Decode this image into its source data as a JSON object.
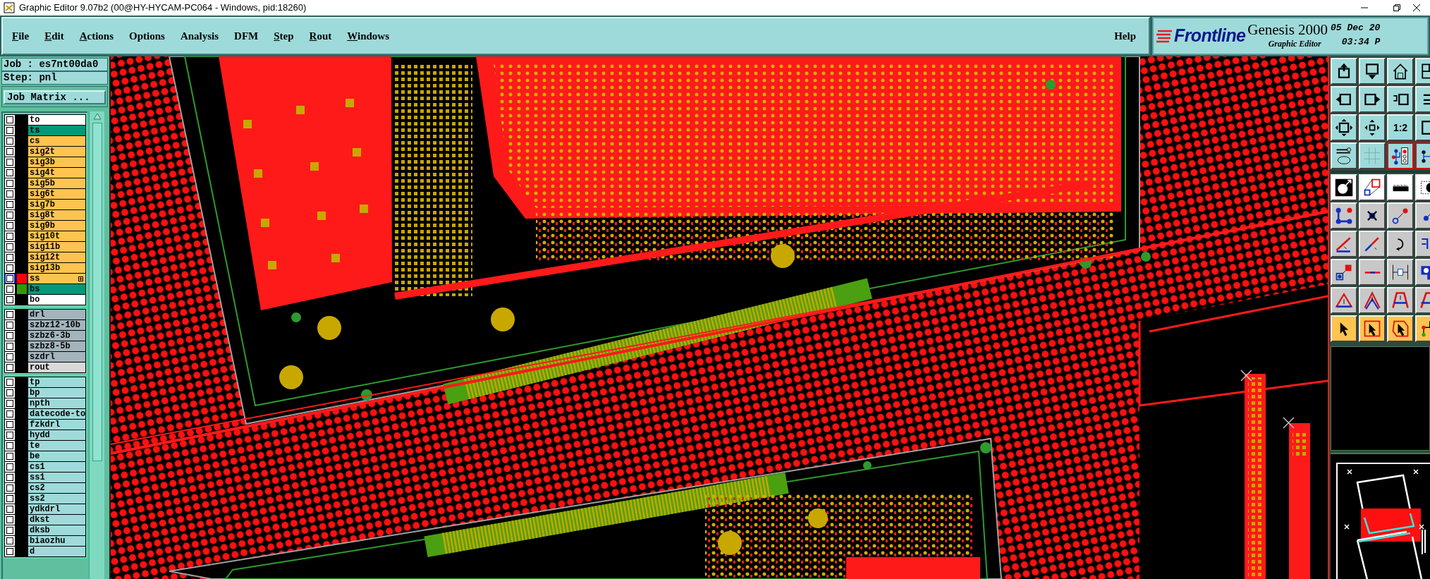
{
  "window": {
    "title": "Graphic Editor 9.07b2 (00@HY-HYCAM-PC064 - Windows, pid:18260)"
  },
  "menu": [
    {
      "label": "File",
      "mnemonic": true
    },
    {
      "label": "Edit",
      "mnemonic": true
    },
    {
      "label": "Actions",
      "mnemonic": true
    },
    {
      "label": "Options",
      "mnemonic": false
    },
    {
      "label": "Analysis",
      "mnemonic": false
    },
    {
      "label": "DFM",
      "mnemonic": false
    },
    {
      "label": "Step",
      "mnemonic": true
    },
    {
      "label": "Rout",
      "mnemonic": true
    },
    {
      "label": "Windows",
      "mnemonic": true
    }
  ],
  "help": "Help",
  "brand": {
    "logo": "Frontline",
    "product": "Genesis 2000",
    "subtitle": "Graphic Editor",
    "date": "05 Dec 20",
    "time": "03:34 P"
  },
  "job": {
    "job": "Job : es7nt00da0",
    "step": "Step: pnl",
    "matrix_button": "Job Matrix ..."
  },
  "layer_groups": [
    {
      "layers": [
        {
          "name": "to",
          "color": "#ffffff",
          "checked": false,
          "selected": false,
          "expandable": false
        },
        {
          "name": "ts",
          "color": "#00997a",
          "checked": false,
          "selected": false,
          "expandable": false
        },
        {
          "name": "cs",
          "color": "#ffc44f",
          "checked": false,
          "selected": false,
          "expandable": false
        },
        {
          "name": "sig2t",
          "color": "#ffc44f",
          "checked": false,
          "selected": false,
          "expandable": false
        },
        {
          "name": "sig3b",
          "color": "#ffc44f",
          "checked": false,
          "selected": false,
          "expandable": false
        },
        {
          "name": "sig4t",
          "color": "#ffc44f",
          "checked": false,
          "selected": false,
          "expandable": false
        },
        {
          "name": "sig5b",
          "color": "#ffc44f",
          "checked": false,
          "selected": false,
          "expandable": false
        },
        {
          "name": "sig6t",
          "color": "#ffc44f",
          "checked": false,
          "selected": false,
          "expandable": false
        },
        {
          "name": "sig7b",
          "color": "#ffc44f",
          "checked": false,
          "selected": false,
          "expandable": false
        },
        {
          "name": "sig8t",
          "color": "#ffc44f",
          "checked": false,
          "selected": false,
          "expandable": false
        },
        {
          "name": "sig9b",
          "color": "#ffc44f",
          "checked": false,
          "selected": false,
          "expandable": false
        },
        {
          "name": "sig10t",
          "color": "#ffc44f",
          "checked": false,
          "selected": false,
          "expandable": false
        },
        {
          "name": "sig11b",
          "color": "#ffc44f",
          "checked": false,
          "selected": false,
          "expandable": false
        },
        {
          "name": "sig12t",
          "color": "#ffc44f",
          "checked": false,
          "selected": false,
          "expandable": false
        },
        {
          "name": "sig13b",
          "color": "#ffc44f",
          "checked": false,
          "selected": false,
          "expandable": false
        },
        {
          "name": "ss",
          "color": "#ffc44f",
          "swatch": {
            "color": "#ff0000"
          },
          "checked": false,
          "selected": true,
          "expandable": true
        },
        {
          "name": "bs",
          "color": "#00997a",
          "swatch": {
            "color": "#339900"
          },
          "checked": false,
          "selected": false,
          "expandable": false
        },
        {
          "name": "bo",
          "color": "#ffffff",
          "checked": false,
          "selected": false,
          "expandable": false
        }
      ]
    },
    {
      "layers": [
        {
          "name": "drl",
          "color": "#a3b4bc",
          "checked": false,
          "selected": false,
          "expandable": false
        },
        {
          "name": "szbz12-10b",
          "color": "#a3b4bc",
          "checked": false,
          "selected": false,
          "expandable": false
        },
        {
          "name": "szbz6-3b",
          "color": "#a3b4bc",
          "checked": false,
          "selected": false,
          "expandable": false
        },
        {
          "name": "szbz8-5b",
          "color": "#a3b4bc",
          "checked": false,
          "selected": false,
          "expandable": false
        },
        {
          "name": "szdrl",
          "color": "#a3b4bc",
          "checked": false,
          "selected": false,
          "expandable": false
        },
        {
          "name": "rout",
          "color": "#d9d9d9",
          "checked": false,
          "selected": false,
          "expandable": false
        }
      ]
    },
    {
      "layers": [
        {
          "name": "tp",
          "color": "#9fdada",
          "checked": false,
          "selected": false,
          "expandable": false
        },
        {
          "name": "bp",
          "color": "#9fdada",
          "checked": false,
          "selected": false,
          "expandable": false
        },
        {
          "name": "npth",
          "color": "#9fdada",
          "checked": false,
          "selected": false,
          "expandable": false
        },
        {
          "name": "datecode-to",
          "color": "#9fdada",
          "checked": false,
          "selected": false,
          "expandable": false
        },
        {
          "name": "fzkdrl",
          "color": "#9fdada",
          "checked": false,
          "selected": false,
          "expandable": false
        },
        {
          "name": "hydd",
          "color": "#9fdada",
          "checked": false,
          "selected": false,
          "expandable": false
        },
        {
          "name": "te",
          "color": "#9fdada",
          "checked": false,
          "selected": false,
          "expandable": false
        },
        {
          "name": "be",
          "color": "#9fdada",
          "checked": false,
          "selected": false,
          "expandable": false
        },
        {
          "name": "cs1",
          "color": "#9fdada",
          "checked": false,
          "selected": false,
          "expandable": false
        },
        {
          "name": "ss1",
          "color": "#9fdada",
          "checked": false,
          "selected": false,
          "expandable": false
        },
        {
          "name": "cs2",
          "color": "#9fdada",
          "checked": false,
          "selected": false,
          "expandable": false
        },
        {
          "name": "ss2",
          "color": "#9fdada",
          "checked": false,
          "selected": false,
          "expandable": false
        },
        {
          "name": "ydkdrl",
          "color": "#9fdada",
          "checked": false,
          "selected": false,
          "expandable": false
        },
        {
          "name": "dkst",
          "color": "#9fdada",
          "checked": false,
          "selected": false,
          "expandable": false
        },
        {
          "name": "dksb",
          "color": "#9fdada",
          "checked": false,
          "selected": false,
          "expandable": false
        },
        {
          "name": "biaozhu",
          "color": "#9fdada",
          "checked": false,
          "selected": false,
          "expandable": false
        },
        {
          "name": "d",
          "color": "#9fdada",
          "checked": false,
          "selected": false,
          "expandable": false
        }
      ]
    }
  ],
  "toolbar": [
    {
      "kind": "view",
      "selected": false
    },
    {
      "kind": "view",
      "selected": false
    },
    {
      "kind": "view",
      "selected": false
    },
    {
      "kind": "view",
      "selected": false
    },
    {
      "kind": "view",
      "selected": false
    },
    {
      "kind": "view",
      "selected": false
    },
    {
      "kind": "view",
      "selected": false
    },
    {
      "kind": "view",
      "selected": false
    },
    {
      "kind": "view",
      "selected": false
    },
    {
      "kind": "view",
      "selected": false
    },
    {
      "kind": "view",
      "selected": false,
      "label": "1:2"
    },
    {
      "kind": "view",
      "selected": false
    },
    {
      "kind": "view",
      "selected": false
    },
    {
      "kind": "view",
      "selected": false
    },
    {
      "kind": "view",
      "selected": true
    },
    {
      "kind": "view",
      "selected": true
    },
    {
      "kind": "mode",
      "selected": false
    },
    {
      "kind": "mode",
      "selected": false
    },
    {
      "kind": "mode",
      "selected": false
    },
    {
      "kind": "mode",
      "selected": false
    },
    {
      "kind": "edit",
      "selected": false
    },
    {
      "kind": "edit",
      "selected": false
    },
    {
      "kind": "edit",
      "selected": false
    },
    {
      "kind": "edit",
      "selected": false
    },
    {
      "kind": "edit",
      "selected": false
    },
    {
      "kind": "edit",
      "selected": false
    },
    {
      "kind": "edit",
      "selected": false
    },
    {
      "kind": "edit",
      "selected": false
    },
    {
      "kind": "edit",
      "selected": false
    },
    {
      "kind": "edit",
      "selected": false
    },
    {
      "kind": "edit",
      "selected": false
    },
    {
      "kind": "edit",
      "selected": false
    },
    {
      "kind": "edit",
      "selected": false
    },
    {
      "kind": "edit",
      "selected": false
    },
    {
      "kind": "edit",
      "selected": false
    },
    {
      "kind": "edit",
      "selected": false
    },
    {
      "kind": "select",
      "selected": false
    },
    {
      "kind": "select",
      "selected": false
    },
    {
      "kind": "select",
      "selected": false
    },
    {
      "kind": "select",
      "selected": false
    }
  ]
}
